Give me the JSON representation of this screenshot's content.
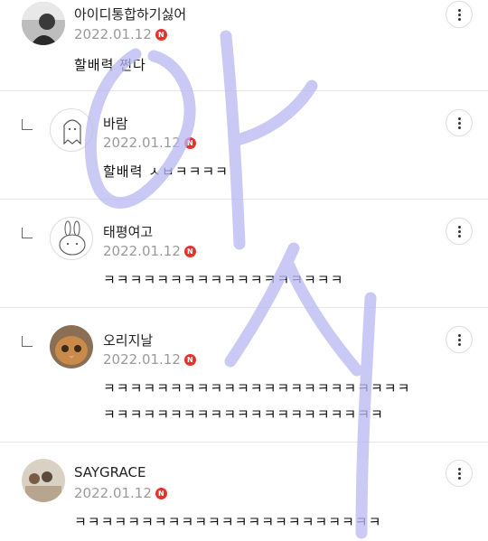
{
  "comments": [
    {
      "nick": "아이디통합하기싫어",
      "date": "2022.01.12",
      "badge": "N",
      "lines": [
        "할배력 쩐다"
      ]
    },
    {
      "nick": "바람",
      "date": "2022.01.12",
      "badge": "N",
      "lines": [
        "할배력 ㅅㅂㅋㅋㅋㅋ"
      ]
    },
    {
      "nick": "태평여고",
      "date": "2022.01.12",
      "badge": "N",
      "lines": [
        "ㅋㅋㅋㅋㅋㅋㅋㅋㅋㅋㅋㅋㅋㅋㅋㅋㅋㅋ"
      ]
    },
    {
      "nick": "오리지날",
      "date": "2022.01.12",
      "badge": "N",
      "lines": [
        "ㅋㅋㅋㅋㅋㅋㅋㅋㅋㅋㅋㅋㅋㅋㅋㅋㅋㅋㅋㅋㅋㅋㅋ",
        "ㅋㅋㅋㅋㅋㅋㅋㅋㅋㅋㅋㅋㅋㅋㅋㅋㅋㅋㅋㅋㅋ"
      ]
    },
    {
      "nick": "SAYGRACE",
      "date": "2022.01.12",
      "badge": "N",
      "lines": [
        "ㅋㅋㅋㅋㅋㅋㅋㅋㅋㅋㅋㅋㅋㅋㅋㅋㅋㅋㅋㅋㅋㅋㅋ"
      ]
    }
  ],
  "watermark_text": "아시",
  "colors": {
    "watermark": "#b9b8f2",
    "badge": "#e6332a"
  },
  "icons": {
    "more": "more-vertical-icon",
    "reply": "reply-arrow-icon"
  }
}
